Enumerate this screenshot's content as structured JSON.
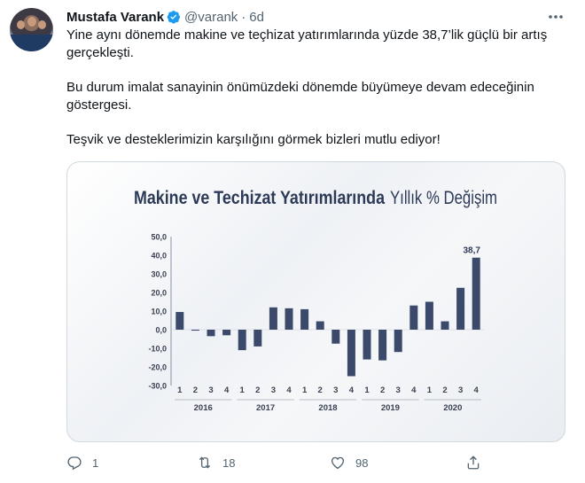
{
  "author": {
    "name": "Mustafa Varank",
    "handle": "@varank",
    "separator": "·",
    "time": "6d"
  },
  "tweet": {
    "paragraphs": [
      "Yine aynı dönemde makine ve teçhizat yatırımlarında yüzde 38,7’lik güçlü bir artış gerçekleşti.",
      "Bu durum imalat sanayinin önümüzdeki dönemde büyümeye devam edeceğinin göstergesi.",
      "Teşvik ve desteklerimizin karşılığını görmek bizleri mutlu ediyor!"
    ]
  },
  "actions": {
    "reply_count": "1",
    "retweet_count": "18",
    "like_count": "98"
  },
  "icons": [
    "verified-badge-icon",
    "more-icon",
    "reply-icon",
    "retweet-icon",
    "like-icon",
    "share-icon"
  ],
  "colors": {
    "accent": "#1d9bf0",
    "bar": "#3b4a6b",
    "title": "#2d3a57"
  },
  "chart_data": {
    "type": "bar",
    "title_bold": "Makine ve Techizat Yatırımlarında",
    "title_light": "Yıllık % Değişim",
    "categories": [
      "1",
      "2",
      "3",
      "4",
      "1",
      "2",
      "3",
      "4",
      "1",
      "2",
      "3",
      "4",
      "1",
      "2",
      "3",
      "4",
      "1",
      "2",
      "3",
      "4"
    ],
    "groups": [
      {
        "label": "2016",
        "count": 4
      },
      {
        "label": "2017",
        "count": 4
      },
      {
        "label": "2018",
        "count": 4
      },
      {
        "label": "2019",
        "count": 4
      },
      {
        "label": "2020",
        "count": 4
      }
    ],
    "values": [
      9.5,
      -0.5,
      -3.5,
      -3.0,
      -11.0,
      -9.0,
      12.0,
      11.5,
      11.0,
      4.5,
      -7.5,
      -25.0,
      -16.0,
      -16.5,
      -12.0,
      13.0,
      15.0,
      4.5,
      22.5,
      38.7
    ],
    "value_labels": [
      {
        "index": 19,
        "text": "38,7"
      }
    ],
    "yticks": [
      "50,0",
      "40,0",
      "30,0",
      "20,0",
      "10,0",
      "0,0",
      "-10,0",
      "-20,0",
      "-30,0"
    ],
    "ylim": [
      -30,
      50
    ],
    "grid": false
  }
}
